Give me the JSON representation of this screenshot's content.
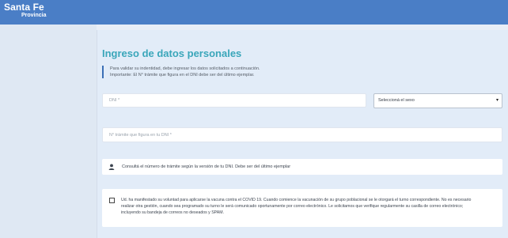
{
  "header": {
    "logo_main": "Santa Fe",
    "logo_sub": "Provincia"
  },
  "form": {
    "title": "Ingreso de datos personales",
    "notice_line1": "Para validar su indentidad, debe ingresar los datos solicitados a continuación.",
    "notice_line2": "Importante: El N° trámite que figura en el DNI debe ser del último ejemplar.",
    "dni_placeholder": "DNI *",
    "sexo_selected": "Seleccioná el sexo",
    "tramite_placeholder": "N° trámite que figura en tu DNI *",
    "info_text": "Consultá el número de trámite según la versión de tu DNI. Debe ser del último ejemplar",
    "consent_line1": "Ud. ha manifestado su voluntad para aplicarse la vacuna contra el COVID 19. Cuando comience la vacunación de su grupo poblacional se le otorgará el turno correspondiente. No es necesario",
    "consent_line2": "realizar otra gestión, cuando sea programado su turno le será comunicado oportunamente por correo electrónico. Le solicitamos que verifique regularmente su casilla de correo electrónico;",
    "consent_line3": "incluyendo su bandeja de correos no deseados y SPAM.",
    "consent_checked": false
  },
  "icons": {
    "user": "user-icon",
    "dropdown": "chevron-down-icon"
  },
  "colors": {
    "header_bg": "#4a7ec6",
    "title": "#3aa6ba",
    "notice_border": "#3b6fb6",
    "page_bg": "#e8eef7"
  }
}
